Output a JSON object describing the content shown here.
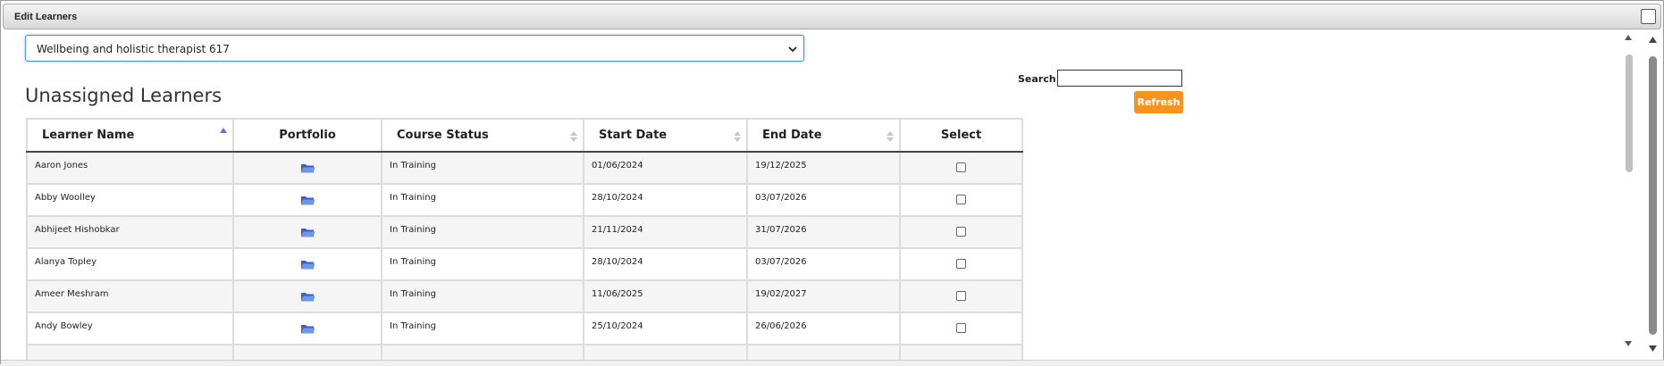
{
  "window": {
    "title": "Edit Learners"
  },
  "course_select": {
    "value": "Wellbeing and holistic therapist 617"
  },
  "heading": "Unassigned Learners",
  "search": {
    "label": "Search:",
    "value": ""
  },
  "refresh_label": "Refresh",
  "columns": [
    "Learner Name",
    "Portfolio",
    "Course Status",
    "Start Date",
    "End Date",
    "Select"
  ],
  "sort": {
    "column": "Learner Name",
    "direction": "ascending"
  },
  "rows": [
    {
      "name": "Aaron Jones",
      "status": "In Training",
      "start": "01/06/2024",
      "end": "19/12/2025"
    },
    {
      "name": "Abby Woolley",
      "status": "In Training",
      "start": "28/10/2024",
      "end": "03/07/2026"
    },
    {
      "name": "Abhijeet Hishobkar",
      "status": "In Training",
      "start": "21/11/2024",
      "end": "31/07/2026"
    },
    {
      "name": "Alanya Topley",
      "status": "In Training",
      "start": "28/10/2024",
      "end": "03/07/2026"
    },
    {
      "name": "Ameer Meshram",
      "status": "In Training",
      "start": "11/06/2025",
      "end": "19/02/2027"
    },
    {
      "name": "Andy Bowley",
      "status": "In Training",
      "start": "25/10/2024",
      "end": "26/06/2026"
    }
  ],
  "icons": {
    "portfolio": "folder-icon",
    "maximize": "maximize-icon"
  },
  "colors": {
    "accent": "#f7941d",
    "focus_border": "#4a90e2"
  }
}
